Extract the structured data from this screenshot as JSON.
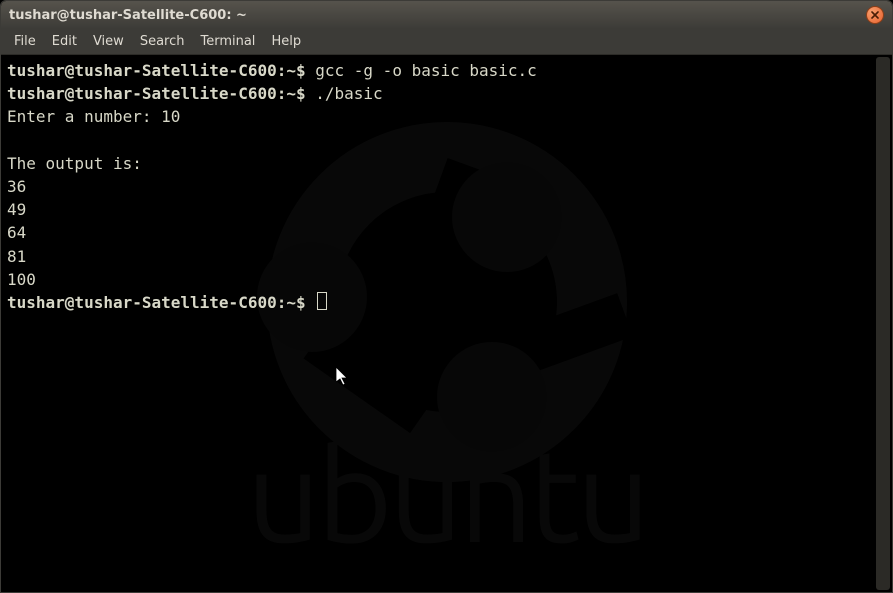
{
  "window": {
    "title": "tushar@tushar-Satellite-C600: ~"
  },
  "menubar": {
    "items": [
      "File",
      "Edit",
      "View",
      "Search",
      "Terminal",
      "Help"
    ]
  },
  "terminal": {
    "prompt": "tushar@tushar-Satellite-C600:~$",
    "lines": [
      {
        "prompt": true,
        "cmd": "gcc -g -o basic basic.c"
      },
      {
        "prompt": true,
        "cmd": "./basic"
      },
      {
        "text": "Enter a number: 10"
      },
      {
        "text": ""
      },
      {
        "text": "The output is:"
      },
      {
        "text": "36"
      },
      {
        "text": "49"
      },
      {
        "text": "64"
      },
      {
        "text": "81"
      },
      {
        "text": "100"
      },
      {
        "prompt": true,
        "cmd": "",
        "cursor": true
      }
    ]
  },
  "watermark_text": "ubuntu"
}
